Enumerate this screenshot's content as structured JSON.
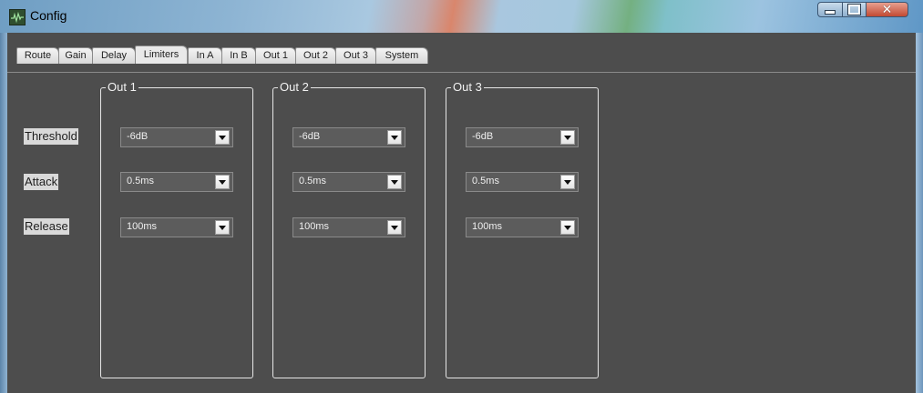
{
  "window": {
    "title": "Config",
    "icon": "waveform-icon",
    "controls": [
      "minimize-icon",
      "maximize-icon",
      "close-icon"
    ]
  },
  "tabs": [
    {
      "label": "Route"
    },
    {
      "label": "Gain"
    },
    {
      "label": "Delay"
    },
    {
      "label": "Limiters",
      "active": true
    },
    {
      "label": "In A"
    },
    {
      "label": "In B"
    },
    {
      "label": "Out 1"
    },
    {
      "label": "Out 2"
    },
    {
      "label": "Out 3"
    },
    {
      "label": "System"
    }
  ],
  "row_labels": {
    "threshold": "Threshold",
    "attack": "Attack",
    "release": "Release"
  },
  "outputs": [
    {
      "title": "Out 1",
      "threshold": "-6dB",
      "attack": "0.5ms",
      "release": "100ms"
    },
    {
      "title": "Out 2",
      "threshold": "-6dB",
      "attack": "0.5ms",
      "release": "100ms"
    },
    {
      "title": "Out 3",
      "threshold": "-6dB",
      "attack": "0.5ms",
      "release": "100ms"
    }
  ],
  "colors": {
    "panel_background": "#4d4d4d",
    "group_border": "#e6e6e6",
    "label_background": "#d9d9d9",
    "combo_background": "#5c5c5c"
  }
}
